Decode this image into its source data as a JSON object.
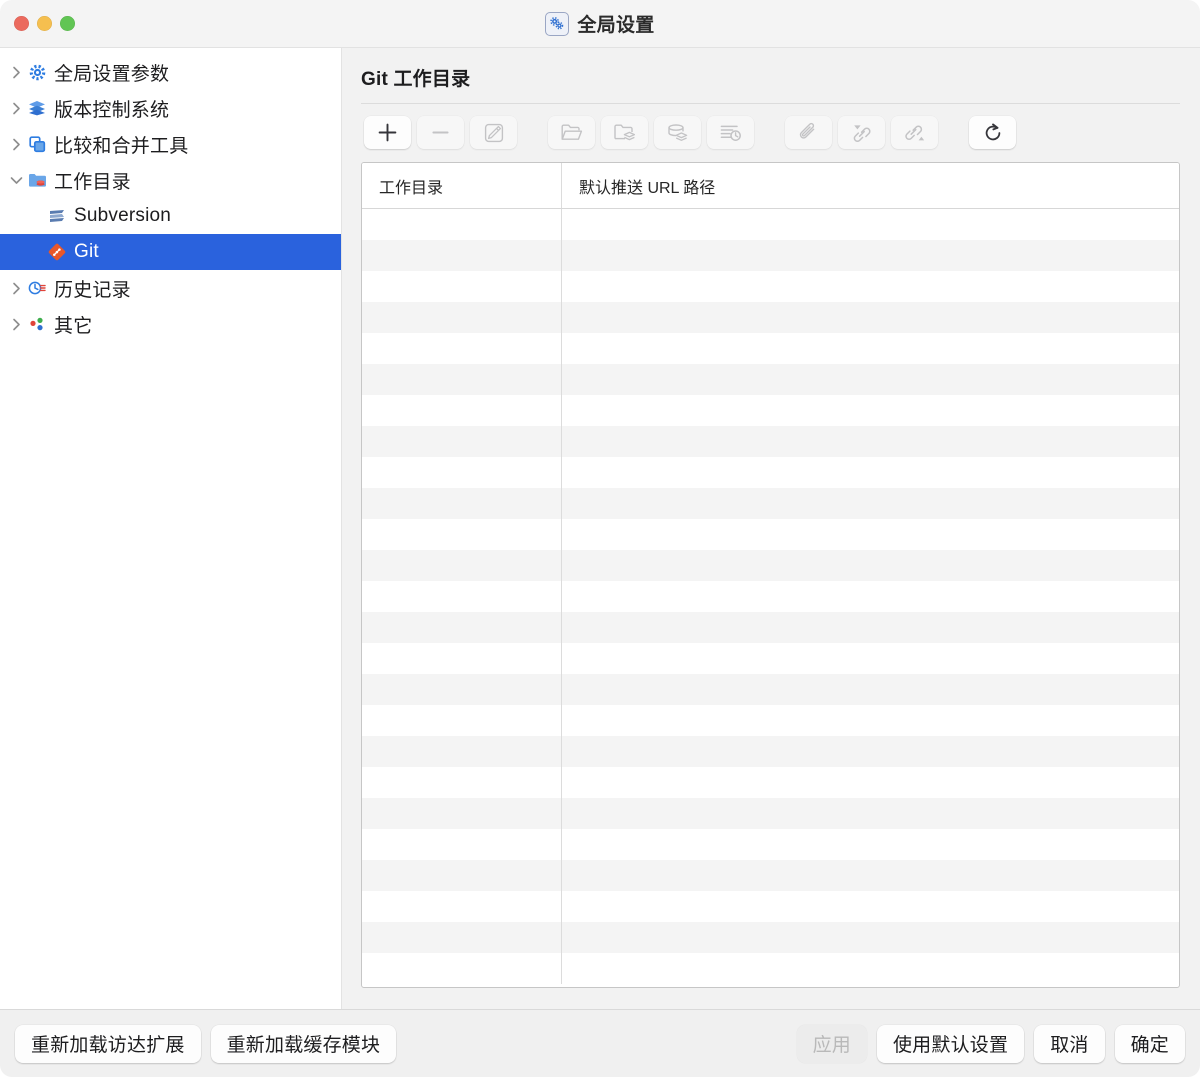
{
  "window": {
    "title": "全局设置",
    "title_icon": "gears-icon",
    "traffic_lights": [
      {
        "name": "close",
        "color": "#eb6a5e"
      },
      {
        "name": "minimize",
        "color": "#f5bf4f"
      },
      {
        "name": "maximize",
        "color": "#61c554"
      }
    ]
  },
  "sidebar": {
    "items": [
      {
        "label": "全局设置参数",
        "icon": "gear-icon",
        "expanded": false,
        "child": false,
        "selected": false,
        "twisty": "right"
      },
      {
        "label": "版本控制系统",
        "icon": "layers-icon",
        "expanded": false,
        "child": false,
        "selected": false,
        "twisty": "right"
      },
      {
        "label": "比较和合并工具",
        "icon": "compare-icon",
        "expanded": false,
        "child": false,
        "selected": false,
        "twisty": "right"
      },
      {
        "label": "工作目录",
        "icon": "folder-db-icon",
        "expanded": true,
        "child": false,
        "selected": false,
        "twisty": "down"
      },
      {
        "label": "Subversion",
        "icon": "subversion-icon",
        "expanded": false,
        "child": true,
        "selected": false,
        "twisty": "none"
      },
      {
        "label": "Git",
        "icon": "git-icon",
        "expanded": false,
        "child": true,
        "selected": true,
        "twisty": "none"
      },
      {
        "label": "历史记录",
        "icon": "history-icon",
        "expanded": false,
        "child": false,
        "selected": false,
        "twisty": "right"
      },
      {
        "label": "其它",
        "icon": "misc-dots-icon",
        "expanded": false,
        "child": false,
        "selected": false,
        "twisty": "right"
      }
    ]
  },
  "main": {
    "title": "Git 工作目录",
    "toolbar": [
      {
        "name": "add-button",
        "icon": "plus-icon",
        "enabled": true,
        "group": 0
      },
      {
        "name": "remove-button",
        "icon": "minus-icon",
        "enabled": false,
        "group": 0
      },
      {
        "name": "edit-button",
        "icon": "pencil-square-icon",
        "enabled": false,
        "group": 0
      },
      {
        "name": "open-folder-button",
        "icon": "folder-open-icon",
        "enabled": false,
        "group": 1
      },
      {
        "name": "folder-repo-button",
        "icon": "folder-stack-icon",
        "enabled": false,
        "group": 1
      },
      {
        "name": "repository-button",
        "icon": "database-stack-icon",
        "enabled": false,
        "group": 1
      },
      {
        "name": "log-history-button",
        "icon": "list-clock-icon",
        "enabled": false,
        "group": 1
      },
      {
        "name": "attach-button",
        "icon": "paperclip-icon",
        "enabled": false,
        "group": 2
      },
      {
        "name": "link-pull-button",
        "icon": "link-down-icon",
        "enabled": false,
        "group": 2
      },
      {
        "name": "link-push-button",
        "icon": "link-up-icon",
        "enabled": false,
        "group": 2
      },
      {
        "name": "refresh-button",
        "icon": "refresh-icon",
        "enabled": true,
        "group": 3
      }
    ],
    "table": {
      "columns": [
        "工作目录",
        "默认推送 URL 路径"
      ],
      "rows": [],
      "empty_row_count": 25
    }
  },
  "footer": {
    "left_buttons": [
      {
        "label": "重新加载访达扩展",
        "enabled": true
      },
      {
        "label": "重新加载缓存模块",
        "enabled": true
      }
    ],
    "right_buttons": [
      {
        "label": "应用",
        "enabled": false
      },
      {
        "label": "使用默认设置",
        "enabled": true
      },
      {
        "label": "取消",
        "enabled": true
      },
      {
        "label": "确定",
        "enabled": true
      }
    ]
  },
  "colors": {
    "selection": "#2a62dd",
    "git_accent": "#e8572a",
    "window_bg": "#ffffff",
    "content_bg": "#f2f2f2",
    "footer_bg": "#f0f0f0"
  }
}
